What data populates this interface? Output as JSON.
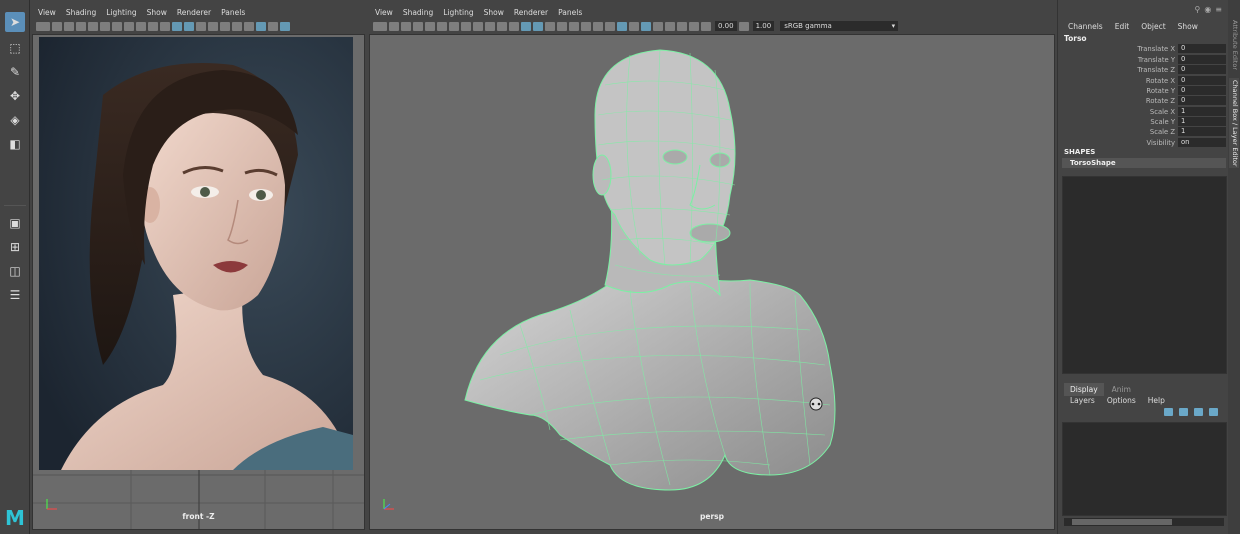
{
  "left_panel": {
    "menus": [
      "View",
      "Shading",
      "Lighting",
      "Show",
      "Renderer",
      "Panels"
    ],
    "label": "front -Z"
  },
  "persp_panel": {
    "menus": [
      "View",
      "Shading",
      "Lighting",
      "Show",
      "Renderer",
      "Panels"
    ],
    "field_a": "0.00",
    "field_b": "1.00",
    "color_space": "sRGB gamma",
    "label": "persp"
  },
  "channel_box": {
    "menus": [
      "Channels",
      "Edit",
      "Object",
      "Show"
    ],
    "object_name": "Torso",
    "attributes": [
      {
        "label": "Translate X",
        "value": "0"
      },
      {
        "label": "Translate Y",
        "value": "0"
      },
      {
        "label": "Translate Z",
        "value": "0"
      },
      {
        "label": "Rotate X",
        "value": "0"
      },
      {
        "label": "Rotate Y",
        "value": "0"
      },
      {
        "label": "Rotate Z",
        "value": "0"
      },
      {
        "label": "Scale X",
        "value": "1"
      },
      {
        "label": "Scale Y",
        "value": "1"
      },
      {
        "label": "Scale Z",
        "value": "1"
      },
      {
        "label": "Visibility",
        "value": "on"
      }
    ],
    "shapes_title": "SHAPES",
    "shape_name": "TorsoShape"
  },
  "layer_editor": {
    "tabs": [
      "Display",
      "Anim"
    ],
    "menus": [
      "Layers",
      "Options",
      "Help"
    ]
  },
  "side_tabs": [
    "Attribute Editor",
    "Channel Box / Layer Editor"
  ],
  "brand": {
    "logo": "M",
    "logo_color": "#2ec4d6",
    "wire_color": "#7cf0a4"
  }
}
